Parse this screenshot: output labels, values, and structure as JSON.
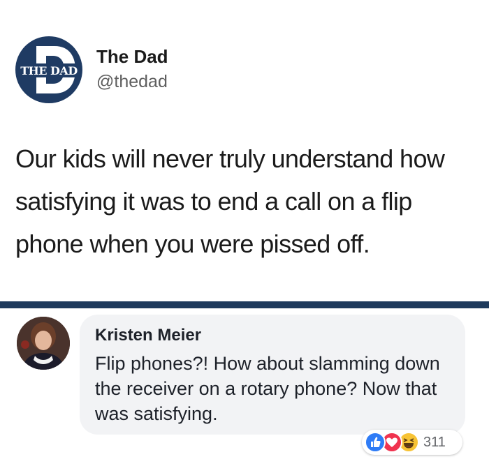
{
  "tweet": {
    "logo_text": "THE DAD",
    "author_name": "The Dad",
    "author_handle": "@thedad",
    "text": "Our kids will never truly understand how satisfying it was to end a call on a flip phone when you were pissed off."
  },
  "comment": {
    "author": "Kristen Meier",
    "text": "Flip phones?!  How about slamming down the receiver on a rotary phone?  Now that was satisfying.",
    "reactions": {
      "icons": [
        "like-icon",
        "love-icon",
        "haha-icon"
      ],
      "count": "311"
    }
  },
  "colors": {
    "brand_navy": "#1f3b63",
    "divider": "#1e3a5c",
    "bubble_bg": "#f2f3f5",
    "like_blue": "#2f7cf6",
    "love_red": "#f0334f",
    "haha_yellow": "#f7c335"
  }
}
